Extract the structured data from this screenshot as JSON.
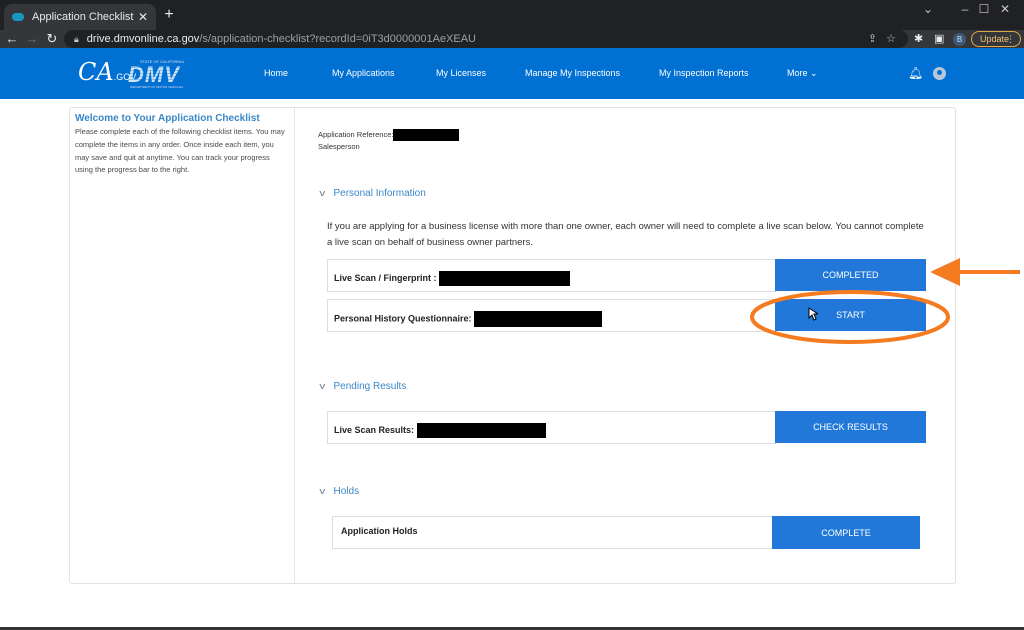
{
  "browser": {
    "tab_title": "Application Checklist",
    "url_host": "drive.dmvonline.ca.gov",
    "url_path": "/s/application-checklist?recordId=0iT3d0000001AeXEAU",
    "update_label": "Update",
    "profile_initial": "B"
  },
  "header": {
    "logo_ca": "CA",
    "logo_gov": ".GOV",
    "logo_dmv_state": "STATE OF CALIFORNIA",
    "logo_dmv": "DMV",
    "logo_dmv_dept": "DEPARTMENT OF MOTOR VEHICLES",
    "nav": [
      "Home",
      "My Applications",
      "My Licenses",
      "Manage My Inspections",
      "My Inspection Reports",
      "More"
    ],
    "brand_color": "#0070d2"
  },
  "sidebar": {
    "title": "Welcome to Your Application Checklist",
    "body": "Please complete each of the following checklist items. You may complete the items in any order. Once inside each item, you may save and quit at anytime. You can track your progress using the progress bar to the right."
  },
  "application": {
    "reference_label": "Application Reference:",
    "role": "Salesperson"
  },
  "sections": {
    "personal": {
      "title": "Personal Information",
      "intro": "If you are applying for a business license with more than one owner, each owner will need to complete a live scan below. You cannot complete a live scan on behalf of business owner partners.",
      "items": [
        {
          "label": "Live Scan / Fingerprint :",
          "button": "COMPLETED"
        },
        {
          "label": "Personal History Questionnaire:",
          "button": "START"
        }
      ]
    },
    "pending": {
      "title": "Pending Results",
      "items": [
        {
          "label": "Live Scan Results:",
          "button": "CHECK RESULTS"
        }
      ]
    },
    "holds": {
      "title": "Holds",
      "items": [
        {
          "label": "Application Holds",
          "button": "COMPLETE"
        }
      ]
    }
  },
  "annotations": {
    "color": "#f47b20"
  }
}
